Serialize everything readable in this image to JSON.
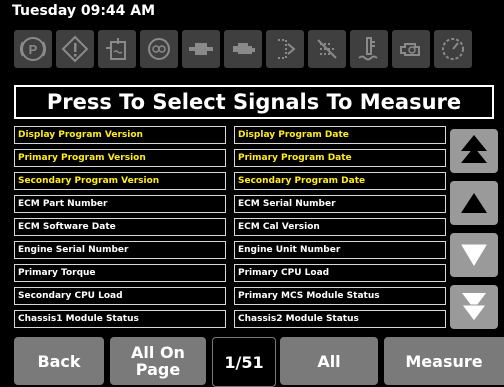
{
  "status": {
    "datetime": "Tuesday 09:44 AM"
  },
  "icon_row": [
    "parking-brake-icon",
    "warning-diamond-icon",
    "coolant-level-icon",
    "oil-icon",
    "fuel-filter-icon",
    "engine-icon",
    "def-dosing-icon",
    "regen-inhibit-icon",
    "coolant-temp-icon",
    "engine-check-icon",
    "gauge-icon"
  ],
  "header": {
    "title": "Press To Select Signals To Measure"
  },
  "signals": [
    {
      "label": "Display Program Version",
      "color": "#ffeb1e"
    },
    {
      "label": "Display Program Date",
      "color": "#ffeb1e"
    },
    {
      "label": "Primary Program Version",
      "color": "#ffeb1e"
    },
    {
      "label": "Primary Program Date",
      "color": "#ffeb1e"
    },
    {
      "label": "Secondary Program Version",
      "color": "#ffeb1e"
    },
    {
      "label": "Secondary Program Date",
      "color": "#ffeb1e"
    },
    {
      "label": "ECM Part Number",
      "color": "#ffffff"
    },
    {
      "label": "ECM Serial Number",
      "color": "#ffffff"
    },
    {
      "label": "ECM Software Date",
      "color": "#ffffff"
    },
    {
      "label": "ECM Cal Version",
      "color": "#ffffff"
    },
    {
      "label": "Engine Serial Number",
      "color": "#ffffff"
    },
    {
      "label": "Engine Unit Number",
      "color": "#ffffff"
    },
    {
      "label": "Primary Torque",
      "color": "#ffffff"
    },
    {
      "label": "Primary CPU Load",
      "color": "#ffffff"
    },
    {
      "label": "Secondary CPU Load",
      "color": "#ffffff"
    },
    {
      "label": "Primary MCS Module Status",
      "color": "#ffffff"
    },
    {
      "label": "Chassis1 Module Status",
      "color": "#ffffff"
    },
    {
      "label": "Chassis2 Module Status",
      "color": "#ffffff"
    }
  ],
  "scroll_buttons": [
    "page-up-icon",
    "scroll-up-icon",
    "scroll-down-icon",
    "page-down-icon"
  ],
  "bottom_bar": {
    "back": "Back",
    "all_on_page_line1": "All On",
    "all_on_page_line2": "Page",
    "page_indicator": "1/51",
    "all": "All",
    "measure": "Measure"
  },
  "colors": {
    "yellow": "#ffeb1e",
    "button_gray": "#7a7a7a",
    "icon_gray": "#3f3f3f"
  }
}
